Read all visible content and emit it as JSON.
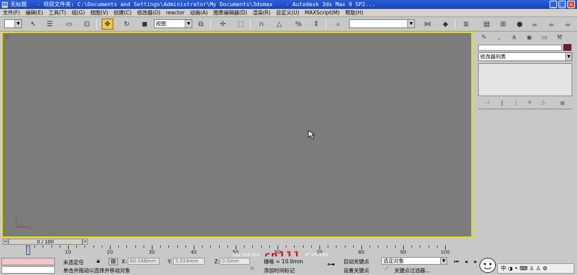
{
  "window": {
    "title": "无标题   - 项目文件夹: C:\\Documents and Settings\\Administrator\\My Documents\\3dsmax    - Autodesk 3ds Max 9 SP2...",
    "minimize": "_",
    "maximize": "□",
    "close": "×"
  },
  "menu": [
    "文件(F)",
    "编辑(E)",
    "工具(T)",
    "组(G)",
    "视图(V)",
    "创建(C)",
    "修改器(O)",
    "reactor",
    "动画(A)",
    "图表编辑器(D)",
    "渲染(R)",
    "自定义(U)",
    "MAXScript(M)",
    "帮助(H)"
  ],
  "toolbar": {
    "reference_coord": "视图"
  },
  "viewport": {
    "label": "顶"
  },
  "command_panel": {
    "modifier_list": "修改器列表",
    "accent_color": "#7a1040"
  },
  "timeline": {
    "frame_display": "0 / 100",
    "ruler_labels": [
      "0",
      "10",
      "20",
      "30",
      "40",
      "50",
      "60",
      "70",
      "80",
      "90",
      "100"
    ]
  },
  "status": {
    "selection": "未选定任",
    "prompt": "单击并拖动以选择并移动对象",
    "x_label": "X:",
    "x_value": "60.048mm",
    "y_label": "Y:",
    "y_value": "5.024mm",
    "z_label": "Z:",
    "z_value": "0.0mm",
    "grid": "栅格 = 10.0mm",
    "add_time_tag": "添加时间标记",
    "auto_key": "自动关键点",
    "set_key": "设置关键点",
    "selected_objects": "选定对象",
    "key_filters": "关键点过滤器..."
  },
  "watermark": {
    "part1": "www.",
    "part2": "cn111",
    "part3": ".com"
  },
  "ime": {
    "text": "中 ◑ • ⌨ ♙ ♙ ⚙"
  }
}
